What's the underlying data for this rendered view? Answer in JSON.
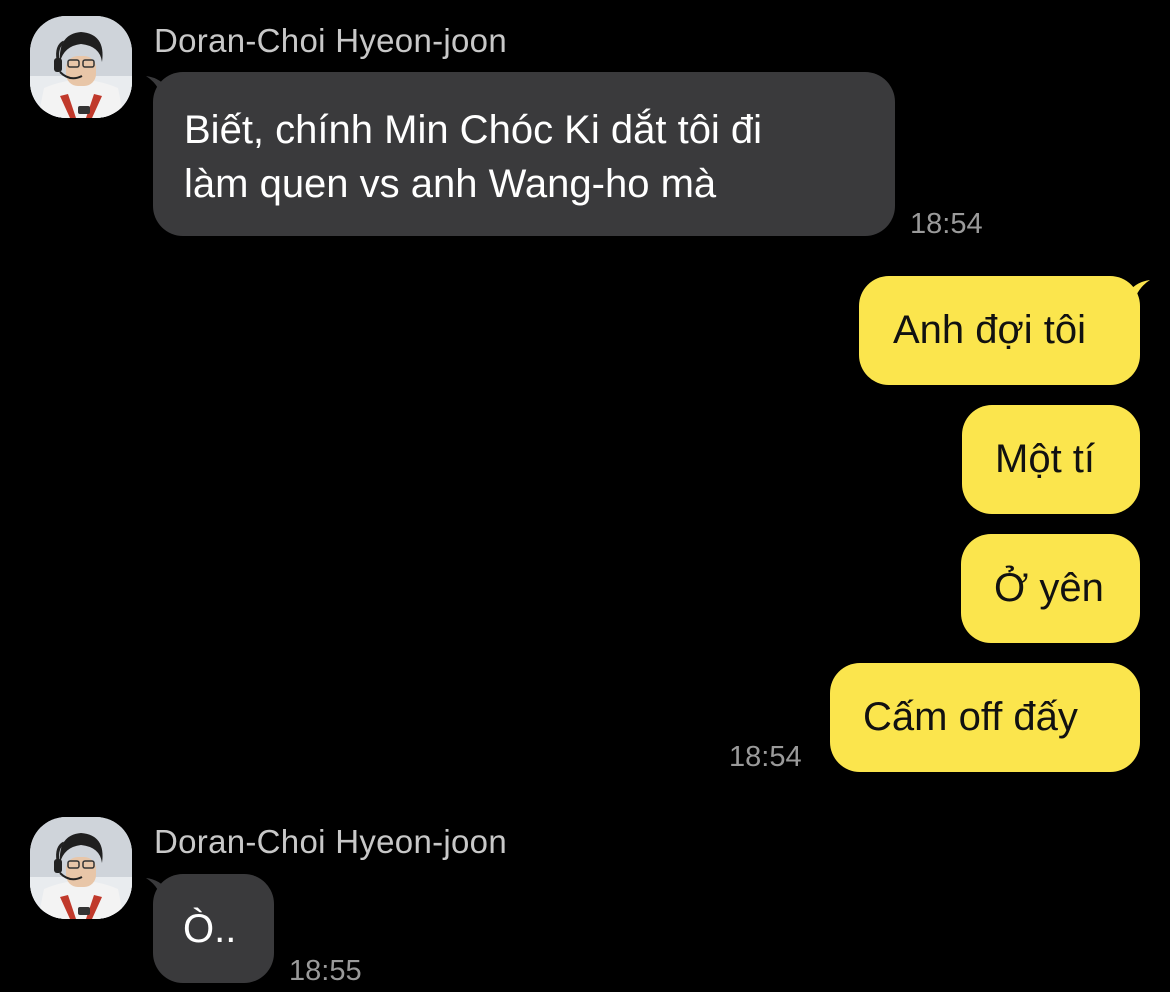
{
  "colors": {
    "background": "#000000",
    "incoming_bubble": "#3a3a3c",
    "outgoing_bubble": "#fbe54d",
    "timestamp": "#9a9a9a",
    "sender_name": "#c8c8c8"
  },
  "groups": [
    {
      "sender": "Doran-Choi Hyeon-joon",
      "avatar_icon": "profile-photo",
      "messages": [
        {
          "lines": [
            "Biết, chính Min Chóc Ki dắt tôi đi",
            "làm quen vs anh Wang-ho mà"
          ]
        }
      ],
      "time": "18:54"
    },
    {
      "sender": "me",
      "messages": [
        {
          "text": "Anh đợi tôi"
        },
        {
          "text": "Một tí"
        },
        {
          "text": "Ở yên"
        },
        {
          "text": "Cấm off đấy"
        }
      ],
      "time": "18:54"
    },
    {
      "sender": "Doran-Choi Hyeon-joon",
      "avatar_icon": "profile-photo",
      "messages": [
        {
          "text": "Ò.."
        }
      ],
      "time": "18:55"
    }
  ]
}
